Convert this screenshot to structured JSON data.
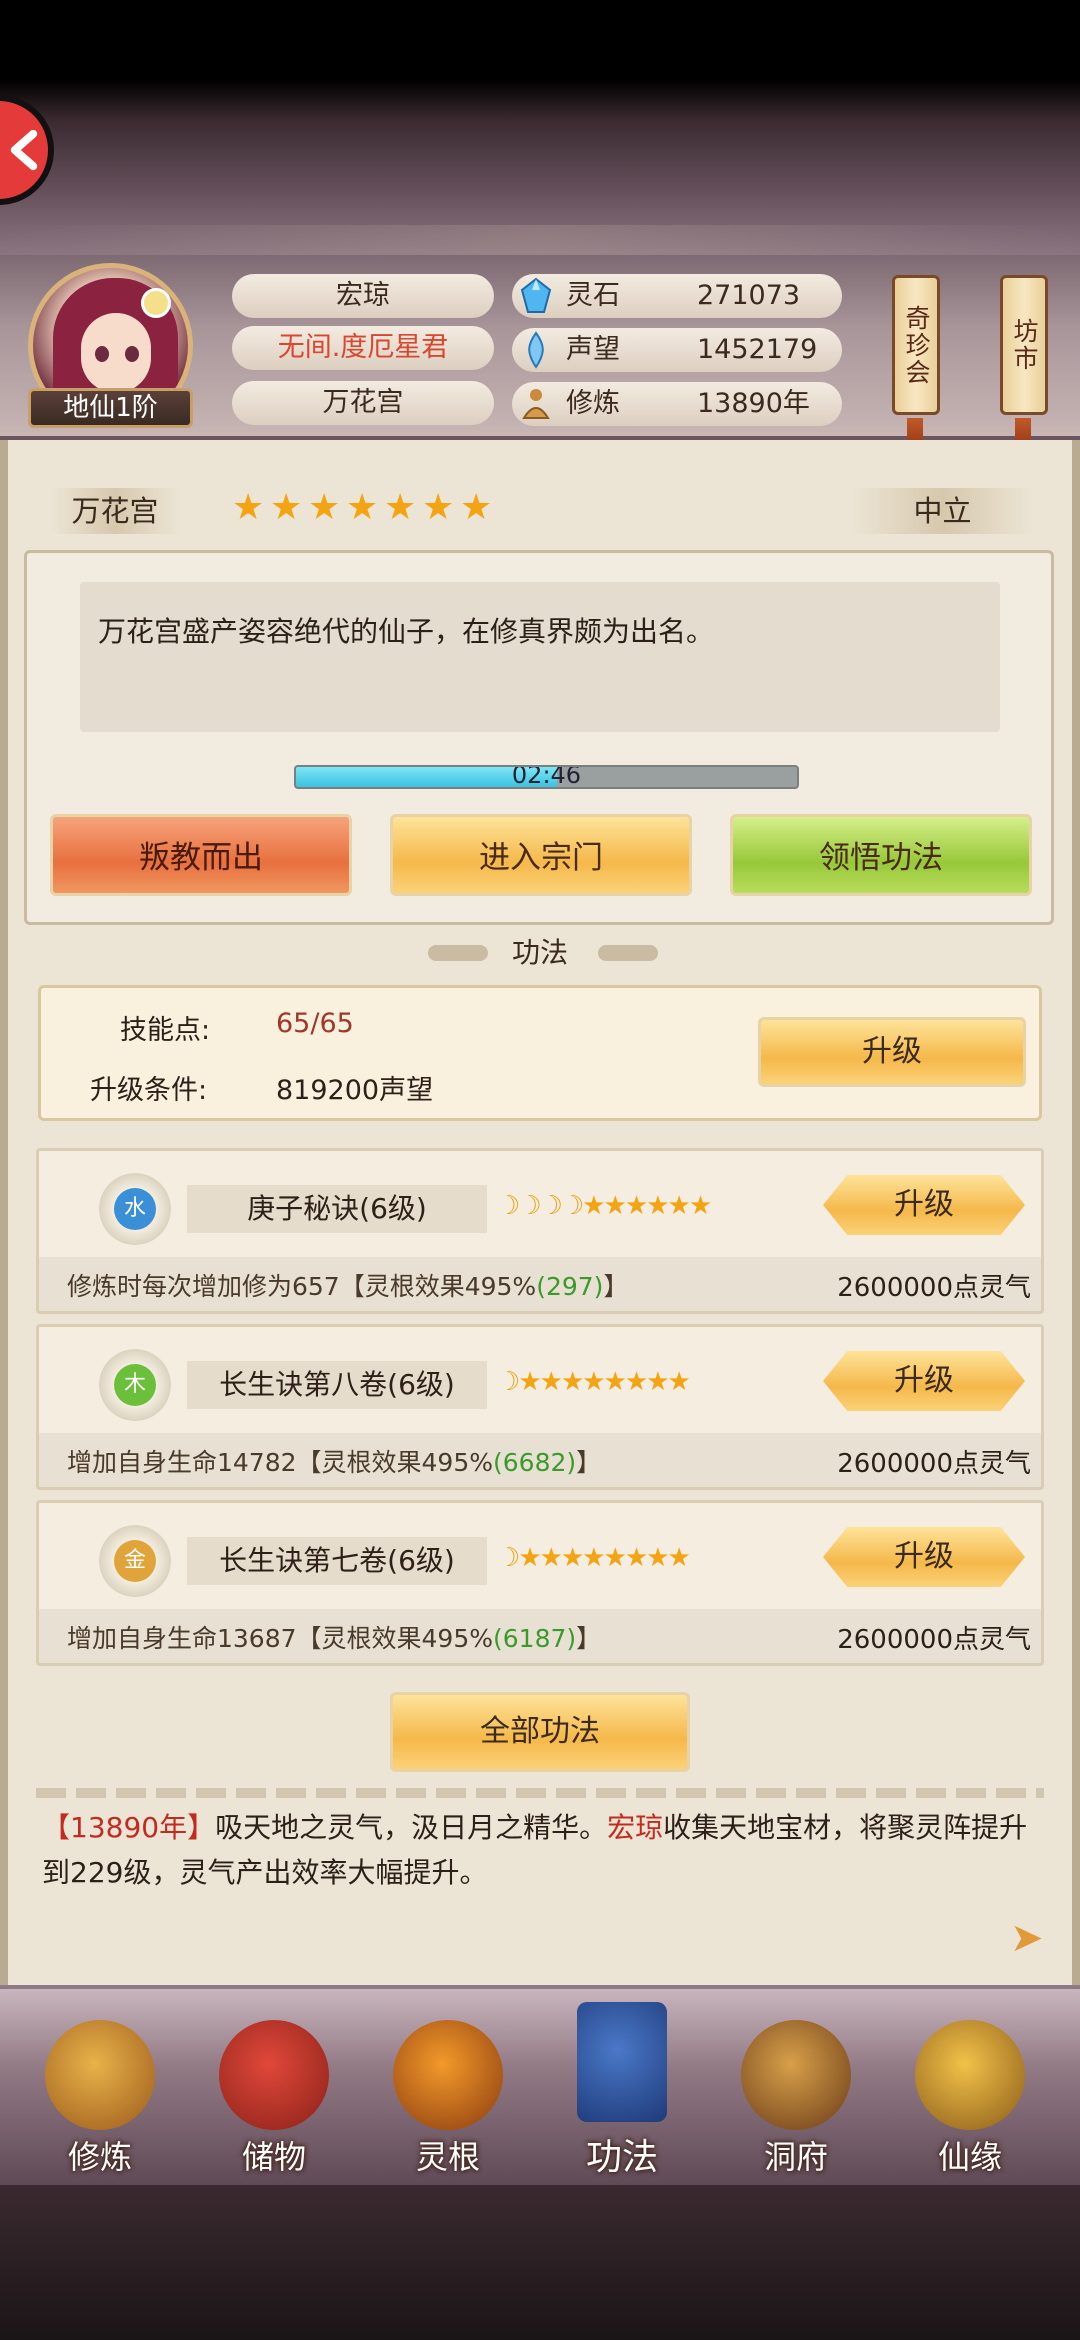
{
  "header": {
    "rank_badge": "地仙1阶",
    "name": "宏琼",
    "title": "无间.度厄星君",
    "sect": "万花宫",
    "stats": [
      {
        "icon": "spirit-stone-icon",
        "label": "灵石",
        "value": "271073"
      },
      {
        "icon": "reputation-icon",
        "label": "声望",
        "value": "1452179"
      },
      {
        "icon": "cultivation-icon",
        "label": "修炼",
        "value": "13890年"
      }
    ],
    "shop_tags": [
      "奇珍会",
      "坊市"
    ]
  },
  "sect_panel": {
    "name": "万花宫",
    "stars": 7,
    "alignment": "中立",
    "description": "万花宫盛产姿容绝代的仙子，在修真界颇为出名。",
    "timer": "02:46",
    "timer_progress": 0.52,
    "buttons": [
      "叛教而出",
      "进入宗门",
      "领悟功法"
    ]
  },
  "techniques_section": {
    "title": "功法",
    "skill_points_label": "技能点:",
    "skill_points_value": "65/65",
    "upgrade_req_label": "升级条件:",
    "upgrade_req_value": "819200声望",
    "upgrade_label": "升级",
    "items": [
      {
        "element": "水",
        "element_color": "#3a8fd6",
        "name": "庚子秘诀(6级)",
        "moons": 4,
        "stars": 6,
        "upgrade": "升级",
        "desc_prefix": "修炼时每次增加修为657【灵根效果495%",
        "desc_highlight": "(297)",
        "desc_suffix": "】",
        "cost": "2600000点灵气"
      },
      {
        "element": "木",
        "element_color": "#6cbf3a",
        "name": "长生诀第八卷(6级)",
        "moons": 1,
        "stars": 8,
        "upgrade": "升级",
        "desc_prefix": "增加自身生命14782【灵根效果495%",
        "desc_highlight": "(6682)",
        "desc_suffix": "】",
        "cost": "2600000点灵气"
      },
      {
        "element": "金",
        "element_color": "#e0a43a",
        "name": "长生诀第七卷(6级)",
        "moons": 1,
        "stars": 8,
        "upgrade": "升级",
        "desc_prefix": "增加自身生命13687【灵根效果495%",
        "desc_highlight": "(6187)",
        "desc_suffix": "】",
        "cost": "2600000点灵气"
      }
    ],
    "all_button": "全部功法"
  },
  "log": {
    "bracket_open": "【",
    "year": "13890年",
    "bracket_close": "】",
    "text1": "吸天地之灵气，汲日月之精华。",
    "name": "宏琼",
    "text2": "收集天地宝材，将聚灵阵提升到229级，灵气产出效率大幅提升。"
  },
  "bottom_nav": [
    {
      "label": "修炼",
      "icon": "cultivate-icon"
    },
    {
      "label": "储物",
      "icon": "storage-bag-icon"
    },
    {
      "label": "灵根",
      "icon": "spirit-root-icon"
    },
    {
      "label": "功法",
      "icon": "technique-book-icon",
      "active": true
    },
    {
      "label": "洞府",
      "icon": "cave-mansion-icon"
    },
    {
      "label": "仙缘",
      "icon": "immortal-fate-icon"
    }
  ],
  "colors": {
    "accent_red": "#c32a20",
    "accent_green": "#3c9a2a",
    "star": "#f4a412"
  }
}
